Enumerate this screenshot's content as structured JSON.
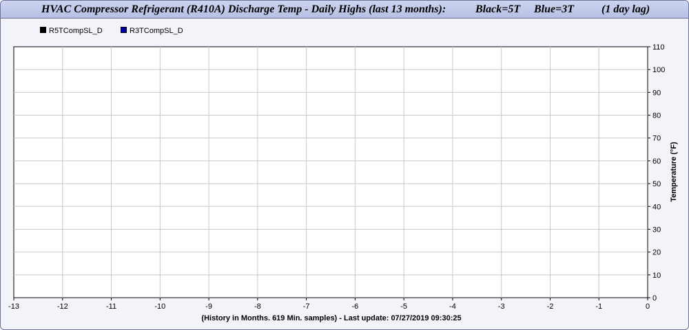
{
  "header": {
    "title": "HVAC Compressor Refrigerant (R410A) Discharge Temp - Daily Highs (last 13 months):",
    "note_black": "Black=5T",
    "note_blue": "Blue=3T",
    "lag": "(1 day lag)"
  },
  "footer": {
    "caption": "(History in Months. 619 Min. samples) - Last update: 07/27/2019 09:30:25"
  },
  "colors": {
    "series_black": "#000000",
    "series_blue": "#0000aa",
    "grid": "#c8c8c8"
  },
  "chart_data": {
    "type": "line",
    "title": "HVAC Compressor Refrigerant (R410A) Discharge Temp - Daily Highs (last 13 months):",
    "xlabel": "",
    "ylabel": "Temperature (°F)",
    "xlim": [
      -13,
      0
    ],
    "ylim": [
      0,
      110
    ],
    "xticks": [
      -13,
      -12,
      -11,
      -10,
      -9,
      -8,
      -7,
      -6,
      -5,
      -4,
      -3,
      -2,
      -1,
      0
    ],
    "yticks": [
      0,
      10,
      20,
      30,
      40,
      50,
      60,
      70,
      80,
      90,
      100,
      110
    ],
    "grid": true,
    "legend_position": "top-left",
    "series": [
      {
        "name": "R5TCompSL_D",
        "color": "#000000",
        "x": [],
        "values": []
      },
      {
        "name": "R3TCompSL_D",
        "color": "#0000aa",
        "x": [],
        "values": []
      }
    ]
  }
}
